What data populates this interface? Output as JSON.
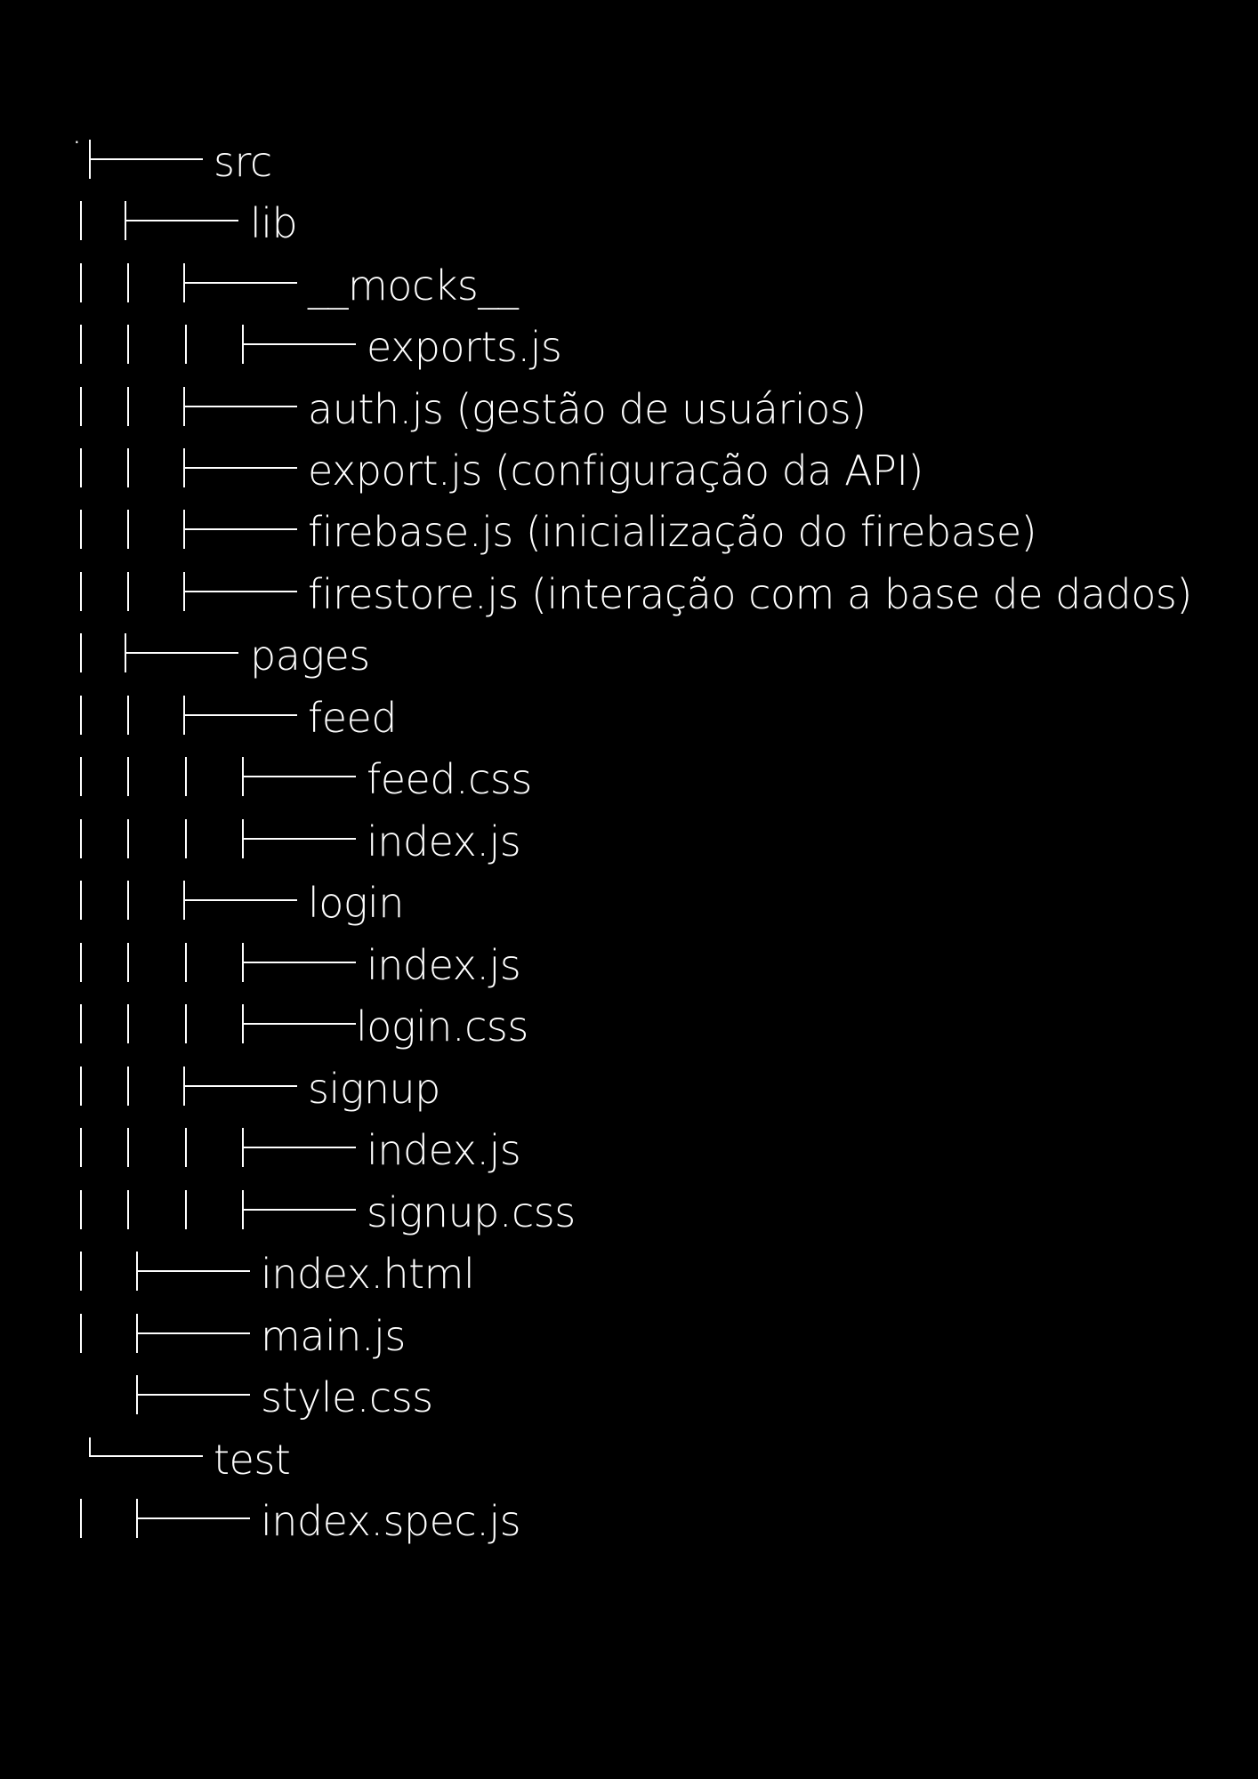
{
  "tree": {
    "root": ".",
    "entries": [
      {
        "name": "src"
      },
      {
        "name": "lib"
      },
      {
        "name": "__mocks__"
      },
      {
        "name": "exports.js"
      },
      {
        "name": "auth.js (gestão de usuários)"
      },
      {
        "name": "export.js (configuração da API)"
      },
      {
        "name": "firebase.js (inicialização do firebase)"
      },
      {
        "name": "firestore.js (interação com a base de dados)"
      },
      {
        "name": "pages"
      },
      {
        "name": "feed"
      },
      {
        "name": "feed.css"
      },
      {
        "name": "index.js"
      },
      {
        "name": "login"
      },
      {
        "name": "index.js"
      },
      {
        "name": "login.css"
      },
      {
        "name": "signup"
      },
      {
        "name": "index.js"
      },
      {
        "name": "signup.css"
      },
      {
        "name": "index.html"
      },
      {
        "name": "main.js"
      },
      {
        "name": "style.css"
      },
      {
        "name": "test"
      },
      {
        "name": "index.spec.js"
      }
    ]
  }
}
